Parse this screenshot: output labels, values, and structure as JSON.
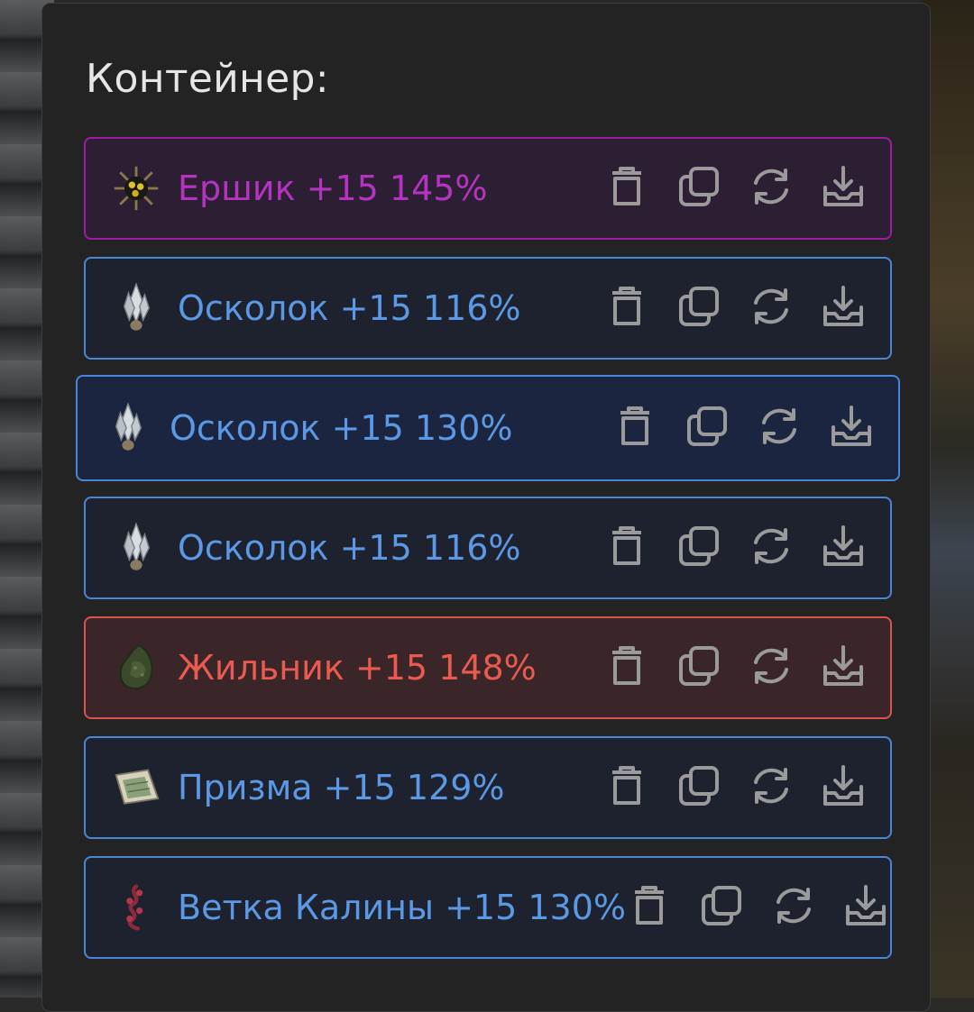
{
  "container": {
    "title": "Контейнер:",
    "items": [
      {
        "label": "Ершик +15 145%",
        "rarity": "purple",
        "icon": "urchin-artifact-icon"
      },
      {
        "label": "Осколок +15 116%",
        "rarity": "blue",
        "icon": "crystal-shard-icon"
      },
      {
        "label": "Осколок +15 130%",
        "rarity": "blue",
        "icon": "crystal-shard-icon",
        "selected": true
      },
      {
        "label": "Осколок +15 116%",
        "rarity": "blue",
        "icon": "crystal-shard-icon"
      },
      {
        "label": "Жильник +15 148%",
        "rarity": "red",
        "icon": "mossy-rock-icon"
      },
      {
        "label": "Призма +15 129%",
        "rarity": "blue",
        "icon": "prism-plate-icon"
      },
      {
        "label": "Ветка Калины +15 130%",
        "rarity": "blue",
        "icon": "viburnum-branch-icon"
      }
    ],
    "actions": [
      "trash-icon",
      "copy-icon",
      "refresh-icon",
      "download-icon"
    ]
  },
  "colors": {
    "purple": "#b533c0",
    "blue": "#5b99e6",
    "red": "#ea5a4f",
    "icon_gray": "#9a9a9a",
    "panel_bg": "#232323"
  }
}
